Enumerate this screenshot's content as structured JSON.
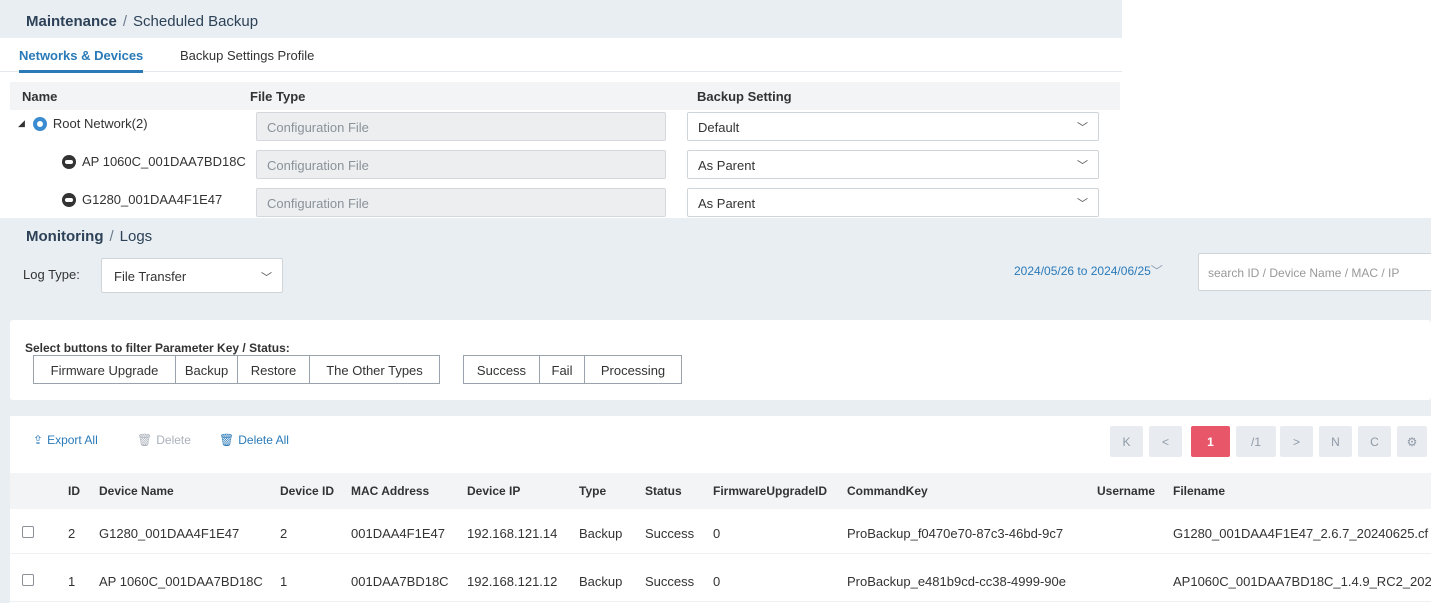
{
  "scheduled_backup": {
    "breadcrumb": {
      "section": "Maintenance",
      "separator": "/",
      "page": "Scheduled Backup"
    },
    "tabs": [
      {
        "label": "Networks & Devices",
        "active": true
      },
      {
        "label": "Backup Settings Profile",
        "active": false
      }
    ],
    "columns": {
      "name": "Name",
      "file_type": "File Type",
      "backup_setting": "Backup Setting"
    },
    "rows": [
      {
        "name": "Root Network(2)",
        "icon": "network-icon",
        "file_type": "Configuration File",
        "backup_setting": "Default",
        "expanded": true
      },
      {
        "name": "AP 1060C_001DAA7BD18C",
        "icon": "device-icon",
        "file_type": "Configuration File",
        "backup_setting": "As Parent"
      },
      {
        "name": "G1280_001DAA4F1E47",
        "icon": "device-icon",
        "file_type": "Configuration File",
        "backup_setting": "As Parent"
      }
    ]
  },
  "logs": {
    "breadcrumb": {
      "section": "Monitoring",
      "separator": "/",
      "page": "Logs"
    },
    "log_type": {
      "label": "Log Type:",
      "value": "File Transfer"
    },
    "date_range": "2024/05/26 to 2024/06/25",
    "search": {
      "placeholder": "search ID / Device Name / MAC / IP"
    },
    "filter": {
      "title": "Select buttons to filter Parameter Key / Status:",
      "parameter_keys": [
        "Firmware Upgrade",
        "Backup",
        "Restore",
        "The Other Types"
      ],
      "statuses": [
        "Success",
        "Fail",
        "Processing"
      ]
    },
    "actions": {
      "export_all": "Export All",
      "delete": "Delete",
      "delete_all": "Delete All"
    },
    "pagination": {
      "first": "K",
      "prev": "<",
      "current": "1",
      "total": "/1",
      "next": ">",
      "last": "N",
      "refresh": "C",
      "settings": "⚙"
    },
    "table": {
      "columns": [
        "ID",
        "Device Name",
        "Device ID",
        "MAC Address",
        "Device IP",
        "Type",
        "Status",
        "FirmwareUpgradeID",
        "CommandKey",
        "Username",
        "Filename"
      ],
      "rows": [
        {
          "id": "2",
          "device_name": "G1280_001DAA4F1E47",
          "device_id": "2",
          "mac": "001DAA4F1E47",
          "ip": "192.168.121.14",
          "type": "Backup",
          "status": "Success",
          "fw_id": "0",
          "command_key": "ProBackup_f0470e70-87c3-46bd-9c7",
          "username": "",
          "filename": "G1280_001DAA4F1E47_2.6.7_20240625.cf"
        },
        {
          "id": "1",
          "device_name": "AP 1060C_001DAA7BD18C",
          "device_id": "1",
          "mac": "001DAA7BD18C",
          "ip": "192.168.121.12",
          "type": "Backup",
          "status": "Success",
          "fw_id": "0",
          "command_key": "ProBackup_e481b9cd-cc38-4999-90e",
          "username": "",
          "filename": "AP1060C_001DAA7BD18C_1.4.9_RC2_202"
        }
      ]
    }
  }
}
